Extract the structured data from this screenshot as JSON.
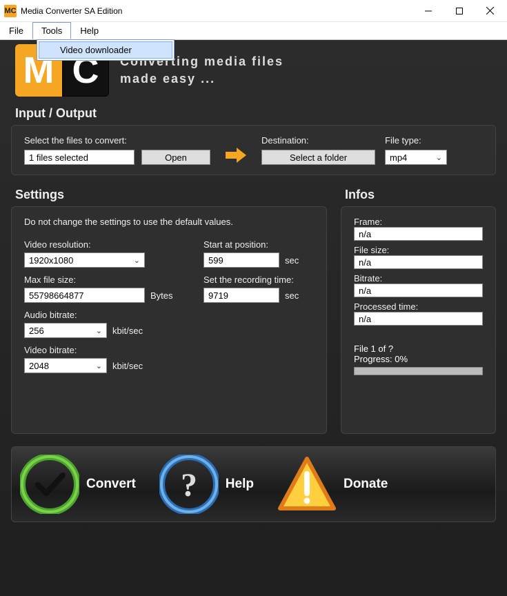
{
  "window": {
    "title": "Media Converter SA Edition",
    "icon_text": "MC"
  },
  "menu": {
    "file": "File",
    "tools": "Tools",
    "help": "Help",
    "tools_dropdown": {
      "video_downloader": "Video downloader"
    }
  },
  "banner": {
    "logo_m": "M",
    "logo_c": "C",
    "tagline_line1": "Converting media files",
    "tagline_line2": "made easy ..."
  },
  "io": {
    "title": "Input / Output",
    "select_label": "Select the files to convert:",
    "files_selected_value": "1 files selected",
    "open_button": "Open",
    "destination_label": "Destination:",
    "destination_value": "Select a folder",
    "file_type_label": "File type:",
    "file_type_value": "mp4"
  },
  "settings": {
    "title": "Settings",
    "note": "Do not change the settings to use the default values.",
    "video_resolution_label": "Video resolution:",
    "video_resolution_value": "1920x1080",
    "max_file_size_label": "Max file size:",
    "max_file_size_value": "55798664877",
    "bytes_unit": "Bytes",
    "audio_bitrate_label": "Audio bitrate:",
    "audio_bitrate_value": "256",
    "kbit_unit": "kbit/sec",
    "video_bitrate_label": "Video bitrate:",
    "video_bitrate_value": "2048",
    "start_pos_label": "Start at position:",
    "start_pos_value": "599",
    "sec_unit": "sec",
    "rec_time_label": "Set the recording time:",
    "rec_time_value": "9719"
  },
  "infos": {
    "title": "Infos",
    "frame_label": "Frame:",
    "frame_value": "n/a",
    "file_size_label": "File size:",
    "file_size_value": "n/a",
    "bitrate_label": "Bitrate:",
    "bitrate_value": "n/a",
    "processed_label": "Processed time:",
    "processed_value": "n/a",
    "file_of": "File 1 of ?",
    "progress": "Progress: 0%"
  },
  "footer": {
    "convert": "Convert",
    "help": "Help",
    "donate": "Donate"
  }
}
